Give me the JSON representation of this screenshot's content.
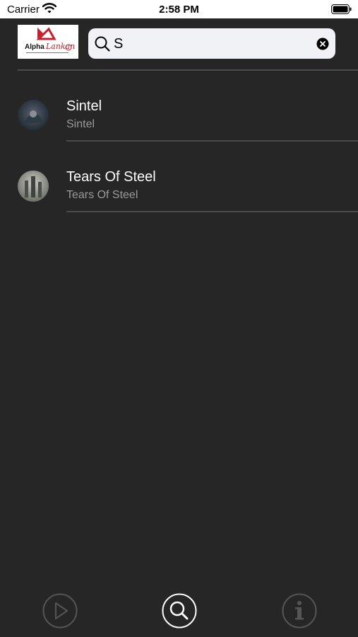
{
  "status_bar": {
    "carrier": "Carrier",
    "time": "2:58 PM"
  },
  "header": {
    "logo_text": "Alpha",
    "logo_script": "Lankan",
    "search": {
      "value": "S",
      "icon": "search-icon",
      "clear_icon": "clear-icon"
    }
  },
  "results": [
    {
      "title": "Sintel",
      "subtitle": "Sintel"
    },
    {
      "title": "Tears Of Steel",
      "subtitle": "Tears Of Steel"
    }
  ],
  "tab_bar": {
    "tabs": [
      {
        "icon": "play-icon",
        "active": false
      },
      {
        "icon": "search-icon",
        "active": true
      },
      {
        "icon": "info-icon",
        "active": false
      }
    ]
  },
  "colors": {
    "background": "#262626",
    "subtitle": "#9a9a9a",
    "divider": "#4b4b4b",
    "logo_accent": "#c8202a"
  }
}
